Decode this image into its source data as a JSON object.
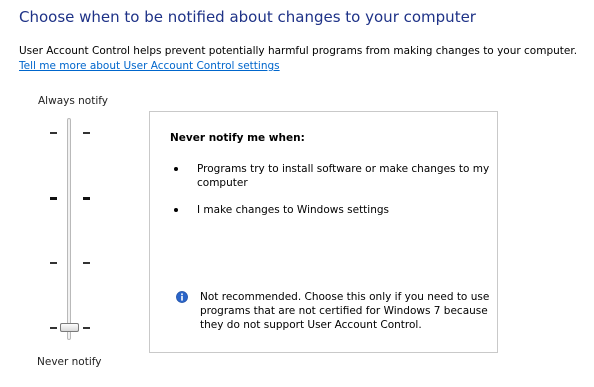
{
  "header": {
    "title": "Choose when to be notified about changes to your computer",
    "description": "User Account Control helps prevent potentially harmful programs from making changes to your computer.",
    "help_link": "Tell me more about User Account Control settings"
  },
  "slider": {
    "top_label": "Always notify",
    "bottom_label": "Never notify",
    "level_count": 4,
    "selected_level": 1,
    "selected_label": "Never notify"
  },
  "details": {
    "heading": "Never notify me when:",
    "items": [
      "Programs try to install software or make changes to my computer",
      "I make changes to Windows settings"
    ],
    "warning": "Not recommended. Choose this only if you need to use programs that are not certified for Windows 7 because they do not support User Account Control.",
    "warning_icon": "info-icon"
  },
  "colors": {
    "title": "#1e3287",
    "link": "#0066cc",
    "info_icon": "#2a64c8",
    "box_border": "#c9c9c9"
  }
}
